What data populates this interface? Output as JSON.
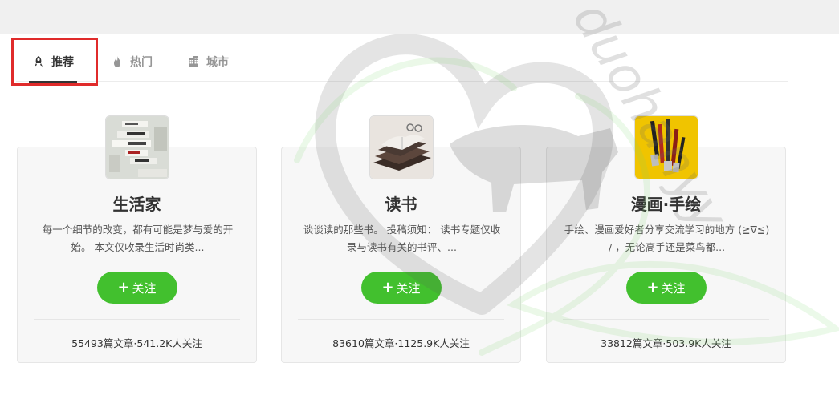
{
  "tabs": [
    {
      "label": "推荐",
      "icon": "rocket-icon",
      "active": true
    },
    {
      "label": "热门",
      "icon": "fire-icon",
      "active": false
    },
    {
      "label": "城市",
      "icon": "building-icon",
      "active": false
    }
  ],
  "cards": [
    {
      "title": "生活家",
      "desc_line1": "每一个细节的改变，都有可能是梦与爱的开",
      "desc_line2": "始。 本文仅收录生活时尚类...",
      "follow_label": "关注",
      "meta": "55493篇文章·541.2K人关注",
      "avatar": "labels-photo"
    },
    {
      "title": "读书",
      "desc_line1": "谈谈读的那些书。 投稿须知： 读书专题仅收",
      "desc_line2": "录与读书有关的书评、...",
      "follow_label": "关注",
      "meta": "83610篇文章·1125.9K人关注",
      "avatar": "books-photo"
    },
    {
      "title": "漫画·手绘",
      "desc_line1": "手绘、漫画爱好者分享交流学习的地方 (≧∇≦)",
      "desc_line2": "/ ，无论高手还是菜鸟都...",
      "follow_label": "关注",
      "meta": "33812篇文章·503.9K人关注",
      "avatar": "brushes-photo"
    }
  ],
  "colors": {
    "accent_green": "#42c02e",
    "highlight_red": "#e02b2b",
    "tab_inactive": "#969696"
  },
  "watermark": {
    "text": "duohanyy"
  }
}
